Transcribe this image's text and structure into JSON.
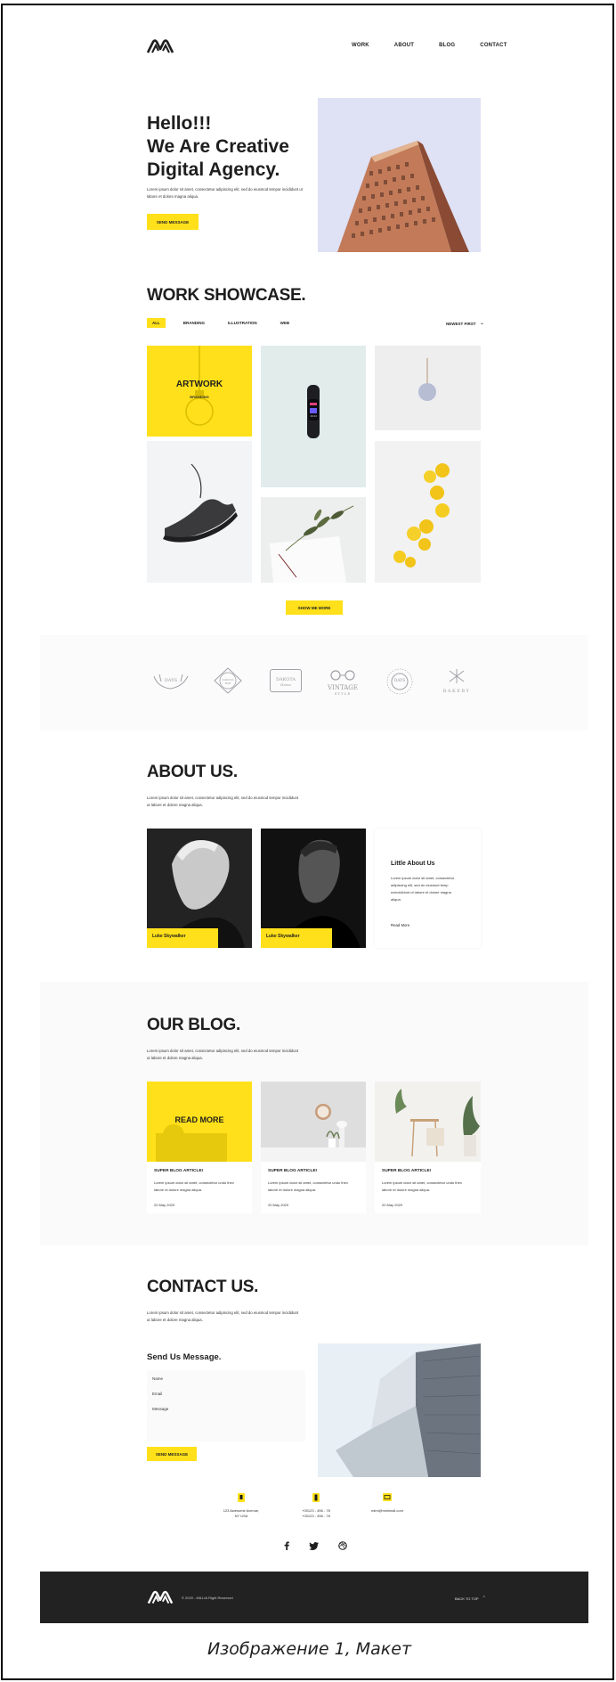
{
  "nav": {
    "items": [
      "WORK",
      "ABOUT",
      "BLOG",
      "CONTACT"
    ]
  },
  "hero": {
    "title_line1": "Hello!!!",
    "title_line2": "We Are Creative",
    "title_line3": "Digital Agency.",
    "text_line1": "Lorem ipsum dolor sit amet, consectetur adipiscing elit, sed do eiusmod tempor incididunt ut",
    "text_line2": "labore et dolore magna aliqua.",
    "button": "SEND MESSAGE"
  },
  "work": {
    "title": "WORK SHOWCASE.",
    "filters": [
      "ALL",
      "BRANDING",
      "ILLUSTRATION",
      "WEB"
    ],
    "sort": "NEWEST FIRST",
    "artwork_title": "ARTWORK",
    "artwork_sub": "BRANDING",
    "watch_time": "16:24",
    "show_more": "SHOW ME MORE"
  },
  "brands": {
    "items": [
      {
        "top": "DAYS",
        "bottom": ""
      },
      {
        "top": "DAKOTA",
        "bottom": "RIDE"
      },
      {
        "top": "DAKOTA",
        "bottom": "Home"
      },
      {
        "top": "VINTAGE",
        "bottom": "STYLE"
      },
      {
        "top": "DAYS",
        "bottom": ""
      },
      {
        "top": "BAKERY",
        "bottom": ""
      }
    ]
  },
  "about": {
    "title": "ABOUT US.",
    "text_line1": "Lorem ipsum dolor sit amet, consectetur adipiscing elit, sed do eiusmod tempor incididunt",
    "text_line2": "ut labore et dolore magna aliqua.",
    "member1": "Luke Skywalker",
    "member2": "Luke Skywalker",
    "card_title": "Little About Us",
    "card_line1": "Lorem ipsum dolor sit amet, consectetur",
    "card_line2": "adipiscing elit, sed do eiusmod temp",
    "card_line3": "ncincididunt ut labore et dolore magna",
    "card_line4": "aliqua.",
    "read_more": "Read More"
  },
  "blog": {
    "title": "OUR BLOG.",
    "text_line1": "Lorem ipsum dolor sit amet, consectetur adipiscing elit, sed do eiusmod tempor incididunt",
    "text_line2": "ut labore et dolore magna aliqua.",
    "overlay": "READ MORE",
    "posts": [
      {
        "title": "SUPER BLOG ARTICLE!",
        "line1": "Lorem ipsum dolor sit amet, consectetur undo thex",
        "line2": "labore et dolore magna aliqua.",
        "date": "20 May 2020"
      },
      {
        "title": "SUPER BLOG ARTICLE!",
        "line1": "Lorem ipsum dolor sit amet, consectetur undo thex",
        "line2": "labore et dolore magna aliqua.",
        "date": "20 May 2020"
      },
      {
        "title": "SUPER BLOG ARTICLE!",
        "line1": "Lorem ipsum dolor sit amet, consectetur undo thex",
        "line2": "labore et dolore magna aliqua.",
        "date": "20 May 2020"
      }
    ]
  },
  "contact": {
    "title": "CONTACT US.",
    "text_line1": "Lorem ipsum dolor sit amet, consectetur adipiscing elit, sed do eiusmod tempor incididunt",
    "text_line2": "ut labore et dolore magna aliqua.",
    "form_title": "Send Us Message.",
    "name_label": "Name",
    "email_label": "Email",
    "message_label": "Message",
    "button": "SEND MESSAGE",
    "address_line1": "123 Awesome Avenue,",
    "address_line2": "NY USA",
    "phone_line1": "+00123 - 456 - 78",
    "phone_line2": "+00123 - 456 - 78",
    "email": "mimi@minimail.com"
  },
  "footer": {
    "copyright": "© 2020 - MILLIA Right Reserved",
    "back_to_top": "BACK TO TOP"
  },
  "caption": "Изображение 1, Макет",
  "colors": {
    "accent": "#ffe01a",
    "dark": "#1e1e1e",
    "footer": "#222222"
  }
}
